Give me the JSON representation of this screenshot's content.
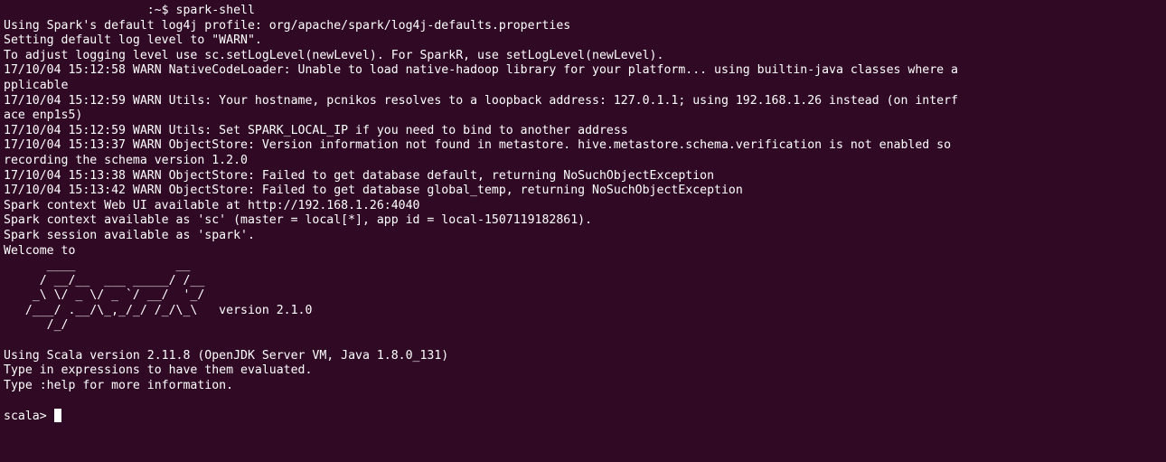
{
  "terminal": {
    "background": "#300a24",
    "foreground": "#ffffff",
    "lines": [
      "                    :~$ spark-shell",
      "Using Spark's default log4j profile: org/apache/spark/log4j-defaults.properties",
      "Setting default log level to \"WARN\".",
      "To adjust logging level use sc.setLogLevel(newLevel). For SparkR, use setLogLevel(newLevel).",
      "17/10/04 15:12:58 WARN NativeCodeLoader: Unable to load native-hadoop library for your platform... using builtin-java classes where a",
      "pplicable",
      "17/10/04 15:12:59 WARN Utils: Your hostname, pcnikos resolves to a loopback address: 127.0.1.1; using 192.168.1.26 instead (on interf",
      "ace enp1s5)",
      "17/10/04 15:12:59 WARN Utils: Set SPARK_LOCAL_IP if you need to bind to another address",
      "17/10/04 15:13:37 WARN ObjectStore: Version information not found in metastore. hive.metastore.schema.verification is not enabled so",
      "recording the schema version 1.2.0",
      "17/10/04 15:13:38 WARN ObjectStore: Failed to get database default, returning NoSuchObjectException",
      "17/10/04 15:13:42 WARN ObjectStore: Failed to get database global_temp, returning NoSuchObjectException",
      "Spark context Web UI available at http://192.168.1.26:4040",
      "Spark context available as 'sc' (master = local[*], app id = local-1507119182861).",
      "Spark session available as 'spark'.",
      "Welcome to",
      "      ____              __",
      "     / __/__  ___ _____/ /__",
      "    _\\ \\/ _ \\/ _ `/ __/  '_/",
      "   /___/ .__/\\_,_/_/ /_/\\_\\   version 2.1.0",
      "      /_/",
      "",
      "Using Scala version 2.11.8 (OpenJDK Server VM, Java 1.8.0_131)",
      "Type in expressions to have them evaluated.",
      "Type :help for more information.",
      ""
    ],
    "prompt": "scala> "
  }
}
